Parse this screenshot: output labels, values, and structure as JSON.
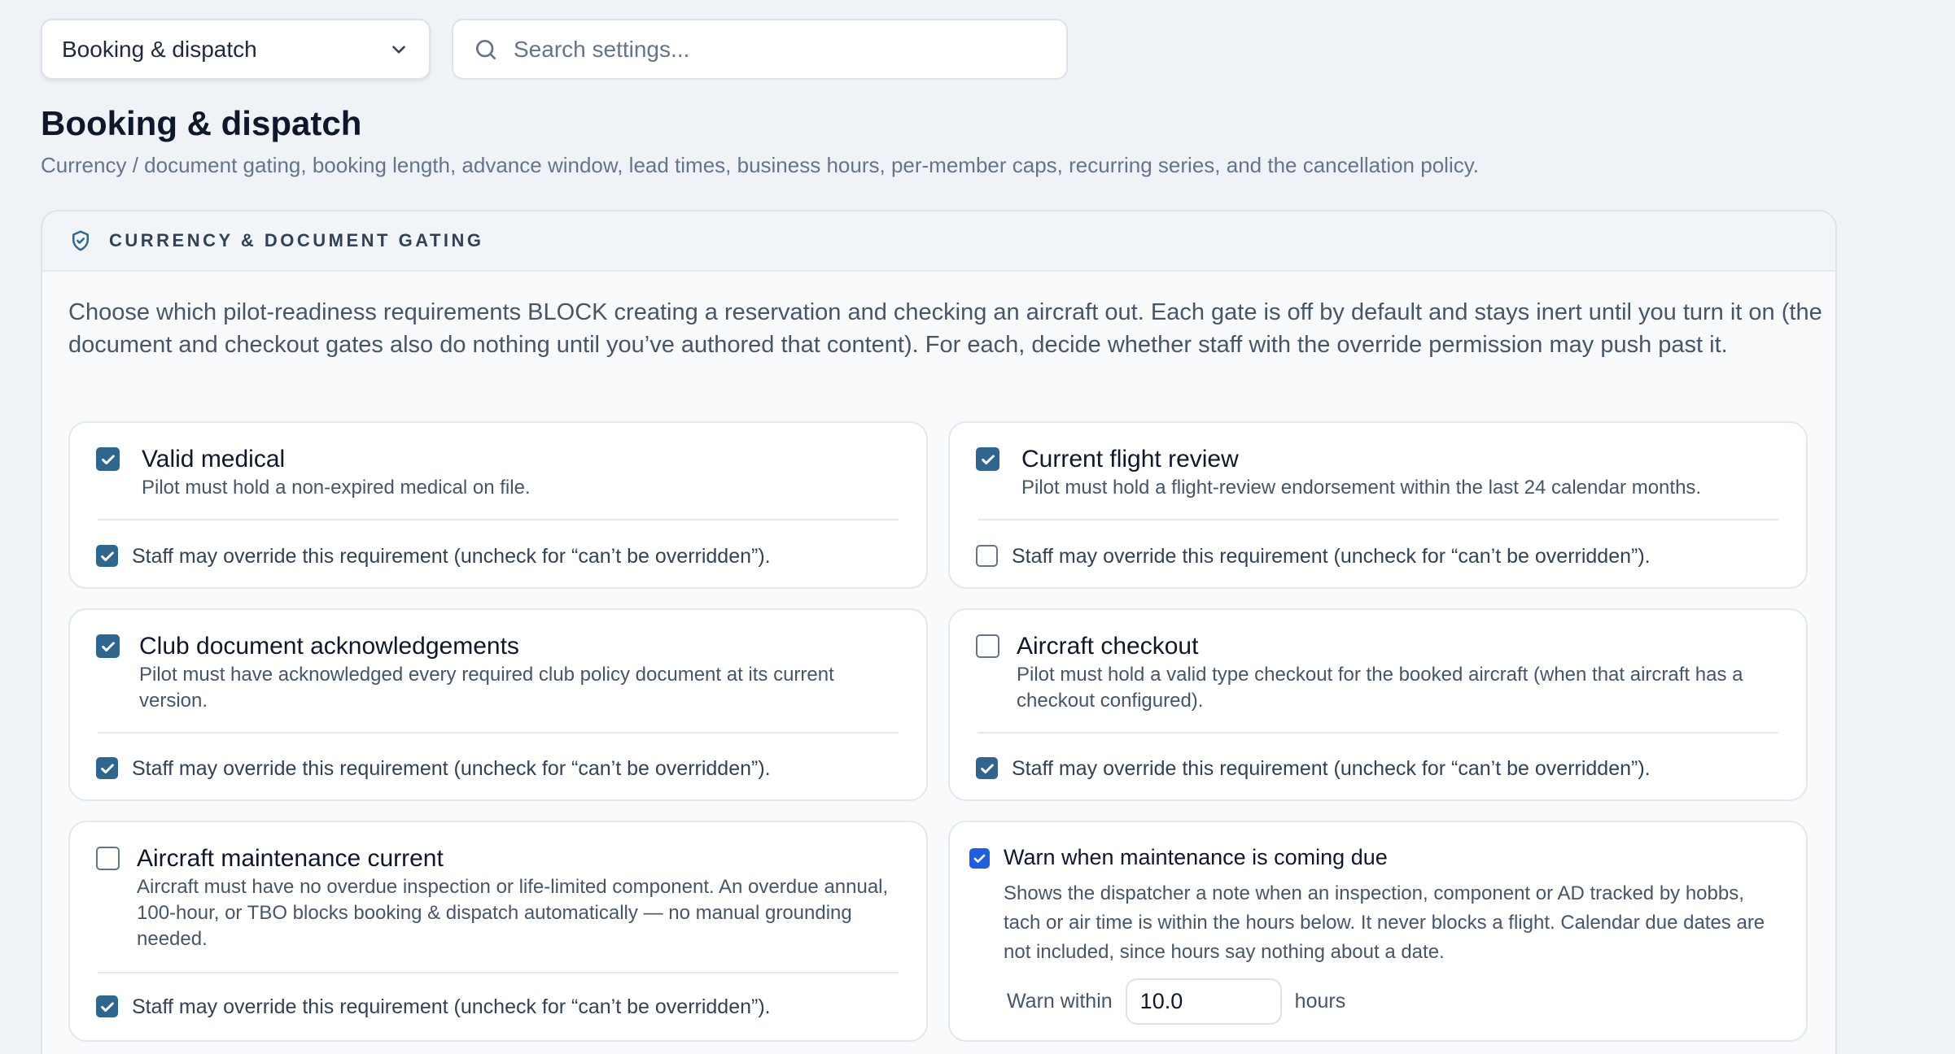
{
  "topbar": {
    "section_select": "Booking & dispatch",
    "search_placeholder": "Search settings..."
  },
  "page": {
    "title": "Booking & dispatch",
    "description": "Currency / document gating, booking length, advance window, lead times, business hours, per-member caps, recurring series, and the cancellation policy."
  },
  "panel": {
    "heading": "CURRENCY & DOCUMENT GATING",
    "intro": "Choose which pilot-readiness requirements BLOCK creating a reservation and checking an aircraft out. Each gate is off by default and stays inert until you turn it on (the document and checkout gates also do nothing until you’ve authored that content). For each, decide whether staff with the override permission may push past it."
  },
  "override_label": "Staff may override this requirement (uncheck for “can’t be overridden”).",
  "gates": [
    {
      "title": "Valid medical",
      "description": "Pilot must hold a non-expired medical on file.",
      "enabled": true,
      "override": true
    },
    {
      "title": "Current flight review",
      "description": "Pilot must hold a flight-review endorsement within the last 24 calendar months.",
      "enabled": true,
      "override": false
    },
    {
      "title": "Club document acknowledgements",
      "description": "Pilot must have acknowledged every required club policy document at its current version.",
      "enabled": true,
      "override": true
    },
    {
      "title": "Aircraft checkout",
      "description": "Pilot must hold a valid type checkout for the booked aircraft (when that aircraft has a checkout configured).",
      "enabled": false,
      "override": true
    },
    {
      "title": "Aircraft maintenance current",
      "description": "Aircraft must have no overdue inspection or life-limited component. An overdue annual, 100-hour, or TBO blocks booking & dispatch automatically — no manual grounding needed.",
      "enabled": false,
      "override": true
    }
  ],
  "warn": {
    "title": "Warn when maintenance is coming due",
    "description": "Shows the dispatcher a note when an inspection, component or AD tracked by hobbs, tach or air time is within the hours below. It never blocks a flight. Calendar due dates are not included, since hours say nothing about a date.",
    "enabled": true,
    "within_label": "Warn within",
    "hours_value": "10.0",
    "unit": "hours"
  },
  "colors": {
    "accent": "#2f6690",
    "warn_accent": "#1d5ee4",
    "background": "#eff3f7"
  },
  "icons": {
    "select": "chevron-down-icon",
    "search": "search-icon",
    "panel": "shield-check-icon",
    "checkbox": "check-icon"
  }
}
